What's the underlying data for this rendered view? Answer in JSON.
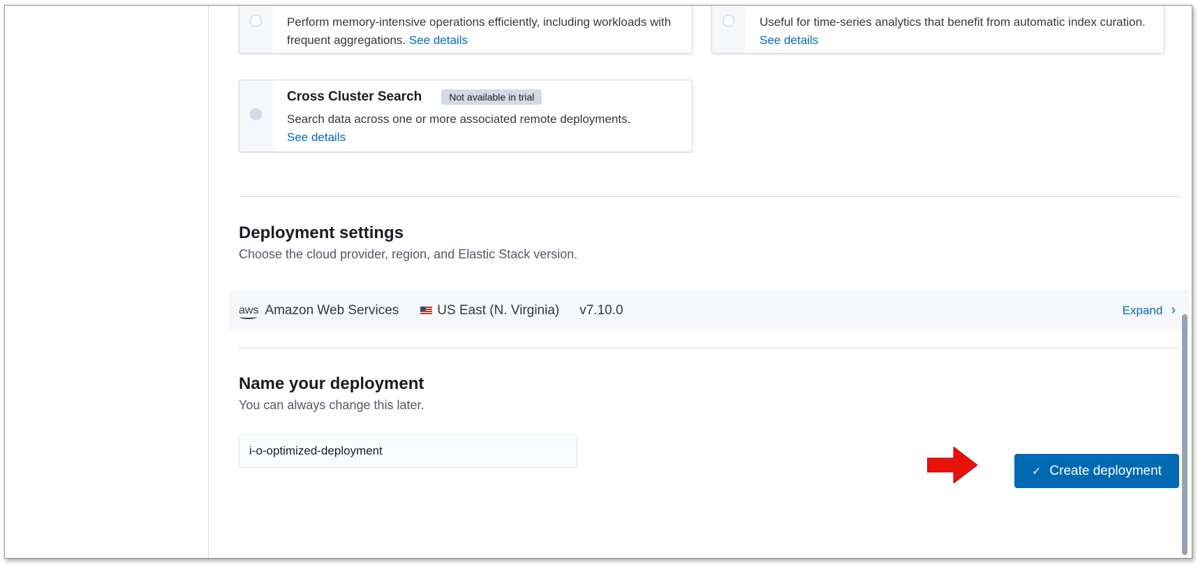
{
  "template_options": {
    "memory_optimized": {
      "description": "Perform memory-intensive operations efficiently, including workloads with frequent aggregations.",
      "link": "See details"
    },
    "index_curation": {
      "description": "Useful for time-series analytics that benefit from automatic index curation.",
      "link": "See details"
    },
    "cross_cluster": {
      "title": "Cross Cluster Search",
      "badge": "Not available in trial",
      "description": "Search data across one or more associated remote deployments.",
      "link": "See details"
    }
  },
  "deployment_settings": {
    "title": "Deployment settings",
    "subtitle": "Choose the cloud provider, region, and Elastic Stack version.",
    "provider_logo": "aws",
    "provider": "Amazon Web Services",
    "region": "US East (N. Virginia)",
    "version": "v7.10.0",
    "expand_label": "Expand",
    "icons": [
      "aws-logo-icon",
      "us-flag-icon",
      "chevron-right-icon"
    ]
  },
  "name_section": {
    "title": "Name your deployment",
    "subtitle": "You can always change this later.",
    "input_value": "i-o-optimized-deployment"
  },
  "actions": {
    "create_label": "Create deployment",
    "create_icon": "check-icon"
  },
  "annotation": {
    "arrow_color": "#e8120c",
    "arrow_icon": "red-arrow-icon"
  },
  "colors": {
    "primary": "#0069b1",
    "link": "#006bb8",
    "badge_bg": "#d3dae6"
  }
}
